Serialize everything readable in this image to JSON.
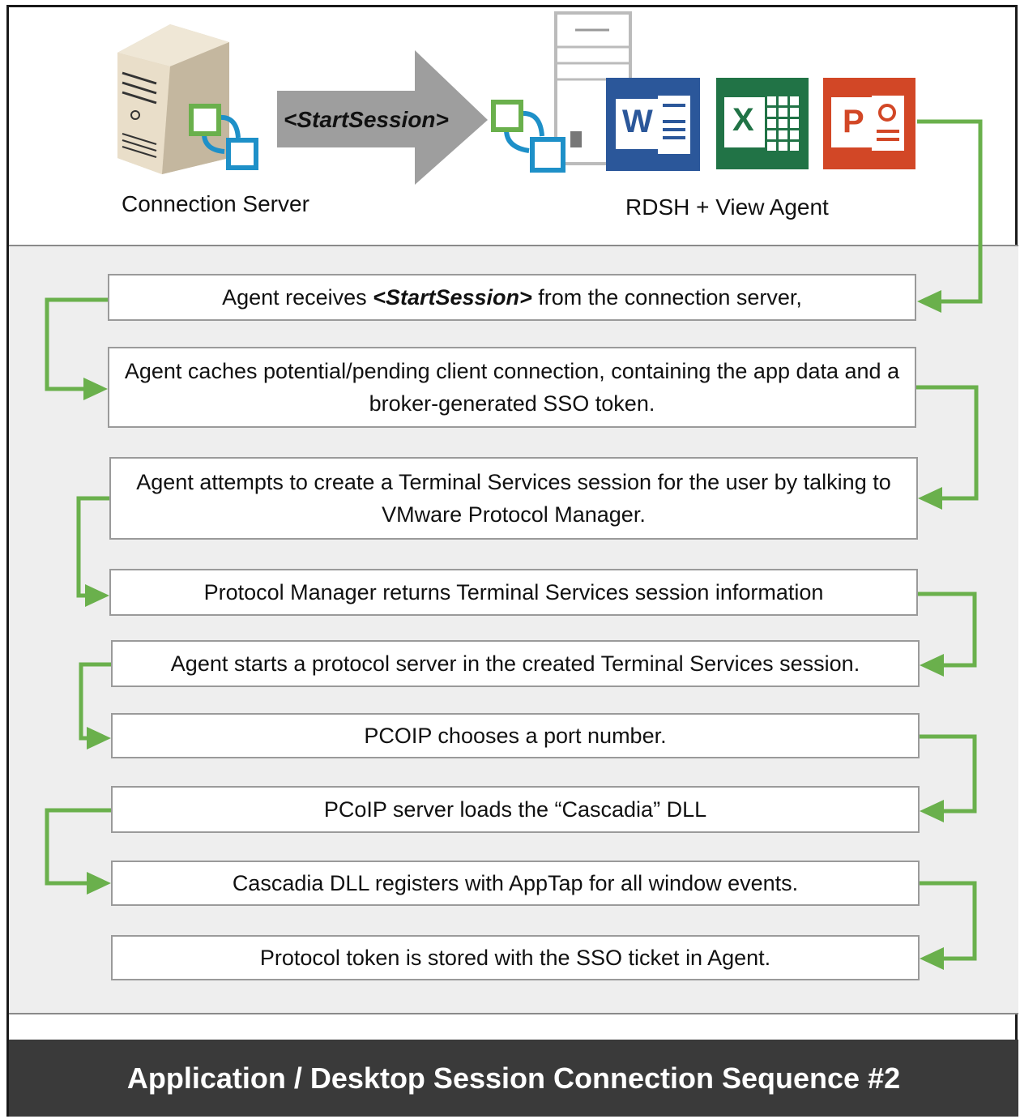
{
  "header": {
    "connection_server_label": "Connection Server",
    "rdsh_label": "RDSH + View Agent",
    "arrow_label": "<StartSession>"
  },
  "steps": [
    {
      "pre": "Agent receives ",
      "em": "<StartSession>",
      "post": " from the connection server,"
    },
    {
      "text": "Agent caches potential/pending client connection, containing the app data and a broker-generated SSO token."
    },
    {
      "text": "Agent attempts to create a Terminal Services session for the user by talking to VMware Protocol Manager."
    },
    {
      "text": "Protocol Manager returns Terminal Services session information"
    },
    {
      "text": "Agent starts a protocol server in the created Terminal Services session."
    },
    {
      "text": "PCOIP chooses a port number."
    },
    {
      "text": "PCoIP server loads the “Cascadia” DLL"
    },
    {
      "text": "Cascadia DLL registers with AppTap for all window events."
    },
    {
      "text": "Protocol token is stored with the SSO ticket in Agent."
    }
  ],
  "footer": {
    "title": "Application / Desktop Session Connection Sequence #2"
  },
  "icons": {
    "word": "W",
    "excel": "X",
    "powerpoint": "P"
  },
  "colors": {
    "connector": "#6ab04c",
    "word": "#2b579a",
    "excel": "#217346",
    "powerpoint": "#d24726",
    "banner": "#3a3a3a",
    "arrow": "#9e9e9e"
  }
}
